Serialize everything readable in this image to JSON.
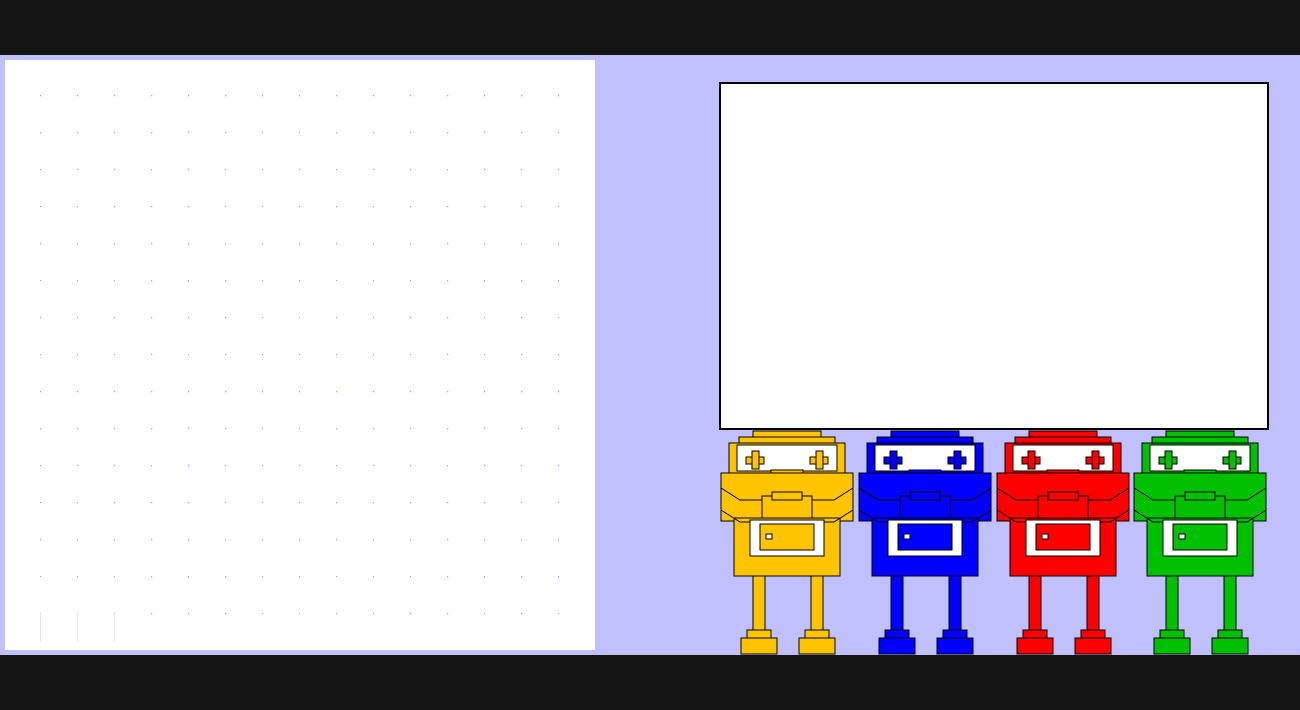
{
  "board": {
    "dot_color": "#a0a0f8",
    "rows": 15,
    "cols": 15
  },
  "message_box": {
    "text": ""
  },
  "robots": [
    {
      "name": "yellow-robot",
      "color": "#ffc400"
    },
    {
      "name": "blue-robot",
      "color": "#0000ff"
    },
    {
      "name": "red-robot",
      "color": "#ff0000"
    },
    {
      "name": "green-robot",
      "color": "#00c000"
    }
  ],
  "colors": {
    "background": "#c0c0fe",
    "frame": "#141414",
    "panel": "#ffffff"
  }
}
